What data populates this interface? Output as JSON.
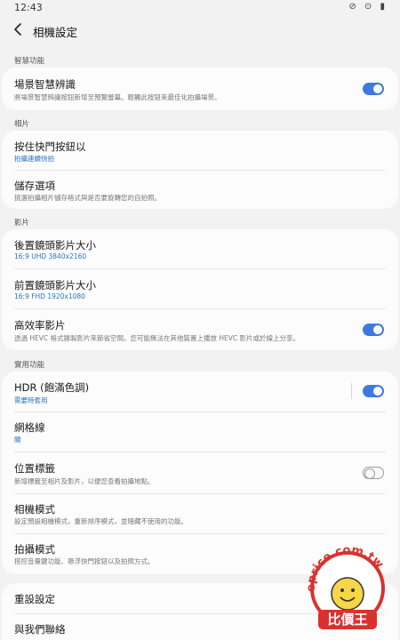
{
  "status": {
    "time": "12:43",
    "icons": "⊘ ⊙ ▮"
  },
  "header": {
    "title": "相機設定"
  },
  "sections": {
    "intelligent": "智慧功能",
    "pictures": "相片",
    "videos": "影片",
    "useful": "實用功能"
  },
  "settings": {
    "scene_optimizer": {
      "title": "場景智慧辨識",
      "desc": "將場景智慧辨識按鈕新增至預覽螢幕。輕觸此按鈕來最佳化拍攝場景。",
      "enabled": true
    },
    "hold_shutter": {
      "title": "按住快門按鈕以",
      "value": "拍攝連續快拍"
    },
    "storage": {
      "title": "儲存選項",
      "desc": "挑選拍攝相片儲存格式與是否要旋轉您的自拍照。"
    },
    "rear_video_size": {
      "title": "後置鏡頭影片大小",
      "value": "16:9 UHD 3840x2160"
    },
    "front_video_size": {
      "title": "前置鏡頭影片大小",
      "value": "16:9 FHD 1920x1080"
    },
    "hevc": {
      "title": "高效率影片",
      "desc": "透過 HEVC 格式錄製影片來節省空間。您可能無法在其他裝置上播放 HEVC 影片或於線上分享。",
      "enabled": true
    },
    "hdr": {
      "title": "HDR (飽滿色調)",
      "value": "需要時套用",
      "enabled": true
    },
    "grid": {
      "title": "網格線",
      "value": "關"
    },
    "location": {
      "title": "位置標籤",
      "desc": "新增標籤至相片及影片，以便您查看拍攝地點。",
      "enabled": false
    },
    "camera_modes": {
      "title": "相機模式",
      "desc": "設定預設相機模式，重新排序模式，並隱藏不使用的功能。"
    },
    "shooting_methods": {
      "title": "拍攝模式",
      "desc": "搭控音量鍵功能、懸浮快門按鈕以及拍照方式。"
    },
    "reset": {
      "title": "重設設定"
    },
    "contact": {
      "title": "與我們聯絡"
    }
  },
  "watermark": {
    "site": "eprice.com.tw",
    "brand": "比價王"
  },
  "colors": {
    "accent": "#3d7ae0",
    "link_blue": "#2a75c4",
    "background": "#f2f2f2",
    "card": "#fcfcfc"
  }
}
